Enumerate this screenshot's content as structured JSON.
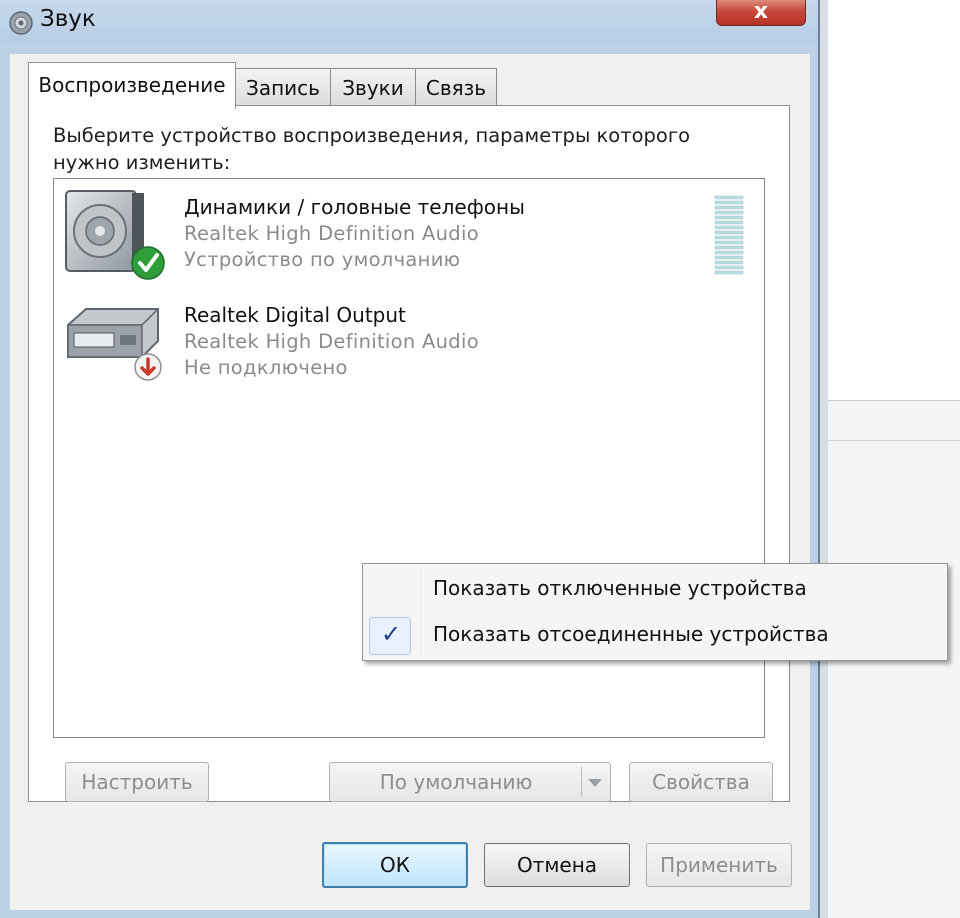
{
  "window": {
    "title": "Звук",
    "close_label": "x"
  },
  "tabs": [
    {
      "label": "Воспроизведение",
      "active": true
    },
    {
      "label": "Запись",
      "active": false
    },
    {
      "label": "Звуки",
      "active": false
    },
    {
      "label": "Связь",
      "active": false
    }
  ],
  "instruction": "Выберите устройство воспроизведения, параметры которого нужно изменить:",
  "devices": [
    {
      "name": "Динамики / головные телефоны",
      "driver": "Realtek High Definition Audio",
      "status": "Устройство по умолчанию",
      "icon": "speaker-icon",
      "badge": "default-check-icon"
    },
    {
      "name": "Realtek Digital Output",
      "driver": "Realtek High Definition Audio",
      "status": "Не подключено",
      "icon": "digital-output-icon",
      "badge": "disconnected-arrow-icon"
    }
  ],
  "buttons": {
    "configure": "Настроить",
    "set_default": "По умолчанию",
    "properties": "Свойства",
    "ok": "ОК",
    "cancel": "Отмена",
    "apply": "Применить"
  },
  "context_menu": {
    "items": [
      {
        "label": "Показать отключенные устройства",
        "checked": false
      },
      {
        "label": "Показать отсоединенные устройства",
        "checked": true
      }
    ],
    "check_glyph": "✓"
  },
  "colors": {
    "default_badge": "#2e9e3a",
    "disconnected_badge": "#c83a2e",
    "level_meter": "#b8dde0"
  }
}
